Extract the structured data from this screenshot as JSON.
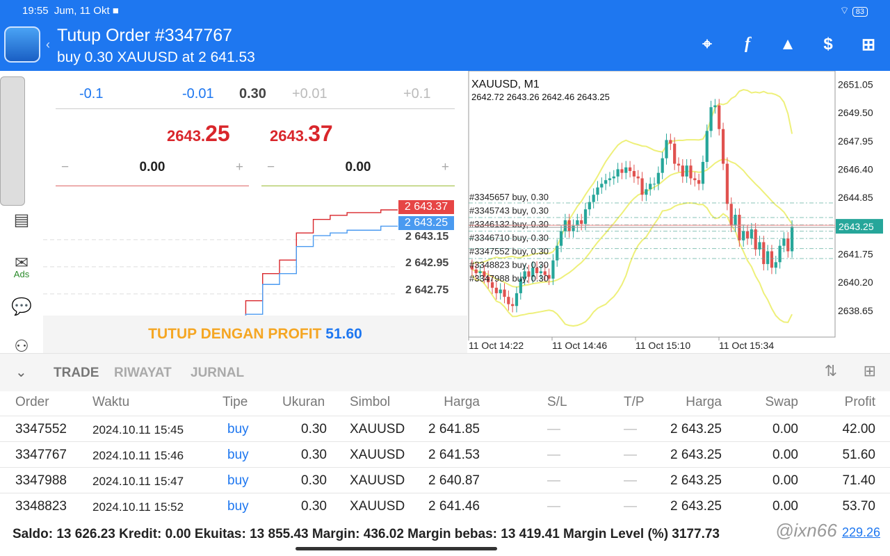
{
  "status": {
    "time": "19:55",
    "date": "Jum, 11 Okt",
    "battery": "83"
  },
  "header": {
    "title": "Tutup Order #3347767",
    "subtitle": "buy 0.30 XAUUSD at 2 641.53",
    "icons": [
      "crosshair-icon",
      "function-icon",
      "objects-icon",
      "dollar-icon",
      "new-order-icon"
    ]
  },
  "sidebar": {
    "ads_label": "Ads"
  },
  "order": {
    "volume": {
      "m01": "-0.1",
      "m001": "-0.01",
      "value": "0.30",
      "p001": "+0.01",
      "p01": "+0.1"
    },
    "bid": {
      "prefix": "2643.",
      "big": "25"
    },
    "ask": {
      "prefix": "2643.",
      "big": "37"
    },
    "sl": {
      "minus": "−",
      "value": "0.00",
      "plus": "+"
    },
    "tp": {
      "minus": "−",
      "value": "0.00",
      "plus": "+"
    },
    "ask_tag": "2 643.37",
    "bid_tag": "2 643.25",
    "scale": [
      "2 643.15",
      "2 642.95",
      "2 642.75"
    ],
    "close_label": "TUTUP DENGAN PROFIT",
    "close_profit": "51.60",
    "ask_series": [
      2642.3,
      2642.3,
      2642.32,
      2642.32,
      2642.35,
      2642.36,
      2642.38,
      2642.38,
      2642.4,
      2642.42,
      2642.45,
      2642.55,
      2642.7,
      2642.9,
      2643.0,
      2643.2,
      2643.3,
      2643.33,
      2643.35,
      2643.35,
      2643.37,
      2643.37
    ],
    "bid_series": [
      2642.2,
      2642.18,
      2642.22,
      2642.22,
      2642.26,
      2642.27,
      2642.28,
      2642.28,
      2642.3,
      2642.31,
      2642.33,
      2642.45,
      2642.6,
      2642.82,
      2642.9,
      2643.1,
      2643.18,
      2643.2,
      2643.22,
      2643.22,
      2643.25,
      2643.25
    ]
  },
  "chart_data": {
    "type": "candlestick",
    "title": "XAUUSD, M1",
    "ohlc_label": "2642.72 2643.26 2642.46 2643.25",
    "ylim": [
      2637.5,
      2651.6
    ],
    "yticks": [
      "2651.05",
      "2649.50",
      "2647.95",
      "2646.40",
      "2644.85",
      "2641.75",
      "2640.20",
      "2638.65"
    ],
    "ytick_values": [
      2651.05,
      2649.5,
      2647.95,
      2646.4,
      2644.85,
      2641.75,
      2640.2,
      2638.65
    ],
    "xticks": [
      "11 Oct 14:22",
      "11 Oct 14:46",
      "11 Oct 15:10",
      "11 Oct 15:34"
    ],
    "current_price": "2643.25",
    "current_value": 2643.25,
    "closes": [
      2640.9,
      2640.7,
      2640.8,
      2640.5,
      2640.2,
      2639.9,
      2639.6,
      2639.8,
      2639.4,
      2639.0,
      2638.9,
      2639.6,
      2640.4,
      2640.8,
      2640.5,
      2641.0,
      2640.7,
      2640.8,
      2640.6,
      2640.4,
      2641.4,
      2642.2,
      2643.0,
      2643.6,
      2643.0,
      2643.3,
      2643.6,
      2643.4,
      2644.2,
      2644.6,
      2645.0,
      2645.4,
      2645.6,
      2645.8,
      2645.9,
      2646.0,
      2646.4,
      2646.2,
      2646.5,
      2646.3,
      2646.0,
      2645.9,
      2645.0,
      2645.3,
      2645.6,
      2645.6,
      2646.2,
      2647.0,
      2648.0,
      2647.8,
      2646.7,
      2646.6,
      2646.0,
      2646.6,
      2645.9,
      2645.8,
      2645.6,
      2646.8,
      2648.5,
      2649.8,
      2649.9,
      2648.6,
      2646.7,
      2644.5,
      2643.3,
      2643.9,
      2642.5,
      2643.0,
      2642.6,
      2643.1,
      2642.0,
      2642.4,
      2641.2,
      2641.9,
      2641.0,
      2641.3,
      2642.2,
      2642.6,
      2641.9,
      2643.25
    ],
    "positions": [
      {
        "label": "#3345657 buy, 0.30",
        "price": 2644.55
      },
      {
        "label": "#3345743 buy, 0.30",
        "price": 2643.75
      },
      {
        "label": "#3346132 buy, 0.30",
        "price": 2643.35
      },
      {
        "label": "#3346710 buy, 0.30",
        "price": 2643.0
      },
      {
        "label": "#3347552 buy, 0.30",
        "price": 2642.6
      },
      {
        "label": "#3348823 buy, 0.30",
        "price": 2642.05
      },
      {
        "label": "#3347988 buy, 0.30",
        "price": 2641.5
      }
    ]
  },
  "tabs": {
    "trade": "TRADE",
    "history": "RIWAYAT",
    "journal": "JURNAL"
  },
  "table": {
    "headers": [
      "Order",
      "Waktu",
      "Tipe",
      "Ukuran",
      "Simbol",
      "Harga",
      "S/L",
      "T/P",
      "Harga",
      "Swap",
      "Profit"
    ],
    "rows": [
      [
        "3347552",
        "2024.10.11 15:45",
        "buy",
        "0.30",
        "XAUUSD",
        "2 641.85",
        "—",
        "—",
        "2 643.25",
        "0.00",
        "42.00"
      ],
      [
        "3347767",
        "2024.10.11 15:46",
        "buy",
        "0.30",
        "XAUUSD",
        "2 641.53",
        "—",
        "—",
        "2 643.25",
        "0.00",
        "51.60"
      ],
      [
        "3347988",
        "2024.10.11 15:47",
        "buy",
        "0.30",
        "XAUUSD",
        "2 640.87",
        "—",
        "—",
        "2 643.25",
        "0.00",
        "71.40"
      ],
      [
        "3348823",
        "2024.10.11 15:52",
        "buy",
        "0.30",
        "XAUUSD",
        "2 641.46",
        "—",
        "—",
        "2 643.25",
        "0.00",
        "53.70"
      ]
    ]
  },
  "footer": {
    "text": "Saldo: 13 626.23  Kredit: 0.00  Ekuitas: 13 855.43  Margin: 436.02  Margin bebas: 13 419.41  Margin Level (%)  3177.73",
    "total": "229.26",
    "watermark": "@ixn66"
  },
  "colors": {
    "blue": "#1e77f0",
    "red": "#d9262b",
    "green": "#26a69a",
    "band": "#eef07a",
    "profit": "#f5a623"
  }
}
